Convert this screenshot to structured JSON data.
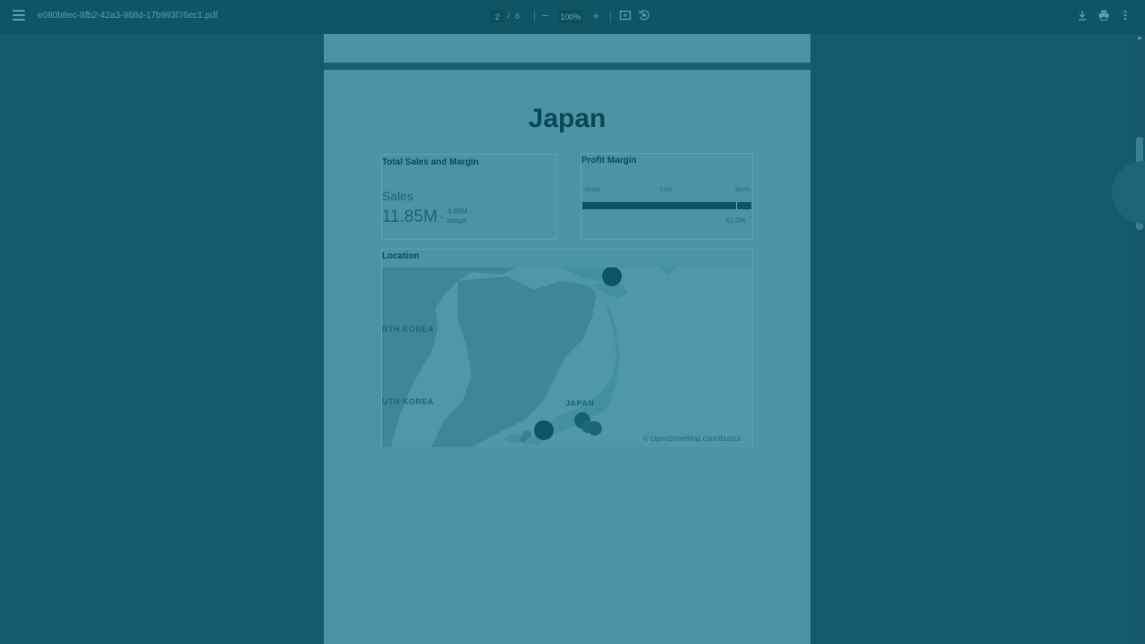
{
  "toolbar": {
    "filename": "e080b8ec-8fb2-42a3-968d-17b993f76ec1.pdf",
    "page_current": "2",
    "page_sep": "/",
    "page_total": "6",
    "zoom": "100%",
    "icons": [
      "menu-icon",
      "zoom-out-icon",
      "zoom-in-icon",
      "fit-page-icon",
      "rotate-icon",
      "download-icon",
      "print-icon",
      "more-icon"
    ]
  },
  "report": {
    "title": "Japan",
    "kpi": {
      "title": "Total Sales and Margin",
      "sales_label": "Sales",
      "sales_value": "11.85M",
      "separator": "-",
      "margin_value": "4.86M -",
      "margin_label": "Margin"
    },
    "gauge": {
      "title": "Profit Margin",
      "tick_min": "-50.0%",
      "tick_mid": "0.0%",
      "tick_max": "50.0%",
      "value_label": "41.0%",
      "value_fraction": 0.91
    },
    "map": {
      "title": "Location",
      "labels": [
        "RTH KOREA",
        "UTH KOREA",
        "JAPAN"
      ],
      "attribution": "© OpenStreetMap contributors"
    }
  },
  "colors": {
    "background": "#165b6b",
    "toolbar": "#105566",
    "page": "#4a94a6",
    "accent": "#0f5464"
  }
}
